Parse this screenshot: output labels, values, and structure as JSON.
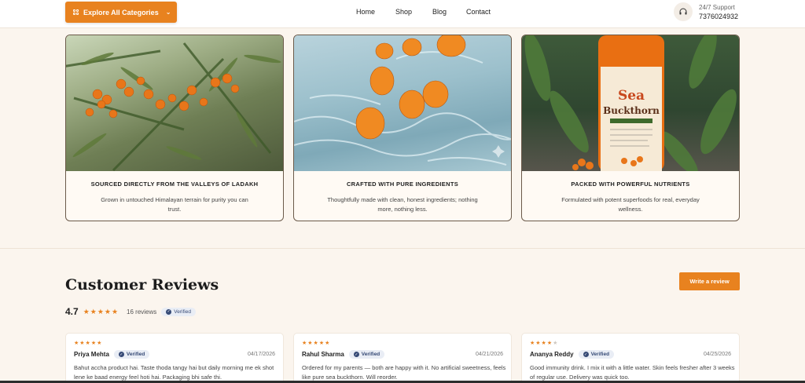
{
  "header": {
    "explore_label": "Explore All Categories",
    "nav": [
      "Home",
      "Shop",
      "Blog",
      "Contact"
    ],
    "support_label": "24/7 Support",
    "support_phone": "7376024932"
  },
  "features": [
    {
      "title": "SOURCED DIRECTLY FROM THE VALLEYS OF LADAKH",
      "desc": "Grown in untouched Himalayan terrain for purity you can trust."
    },
    {
      "title": "CRAFTED WITH PURE INGREDIENTS",
      "desc": "Thoughtfully made with clean, honest ingredients; nothing more, nothing less."
    },
    {
      "title": "PACKED WITH POWERFUL NUTRIENTS",
      "desc": "Formulated with potent superfoods for real, everyday wellness.",
      "bottle_title": "Sea Buckthorn"
    }
  ],
  "reviews": {
    "title": "Customer Reviews",
    "write_label": "Write a review",
    "score": "4.7",
    "count": "16 reviews",
    "verified": "Verified",
    "items": [
      {
        "stars": 5,
        "name": "Priya Mehta",
        "date": "04/17/2026",
        "body": "Bahut accha product hai. Taste thoda tangy hai but daily morning me ek shot lene ke baad energy feel hoti hai. Packaging bhi safe thi."
      },
      {
        "stars": 5,
        "name": "Rahul Sharma",
        "date": "04/21/2026",
        "body": "Ordered for my parents — both are happy with it. No artificial sweetness, feels like pure sea buckthorn. Will reorder."
      },
      {
        "stars": 4,
        "name": "Ananya Reddy",
        "date": "04/25/2026",
        "body": "Good immunity drink. I mix it with a little water. Skin feels fresher after 3 weeks of regular use. Delivery was quick too."
      }
    ]
  },
  "colors": {
    "accent": "#e8821f",
    "background": "#fbf5ee",
    "verified": "#364a76"
  }
}
